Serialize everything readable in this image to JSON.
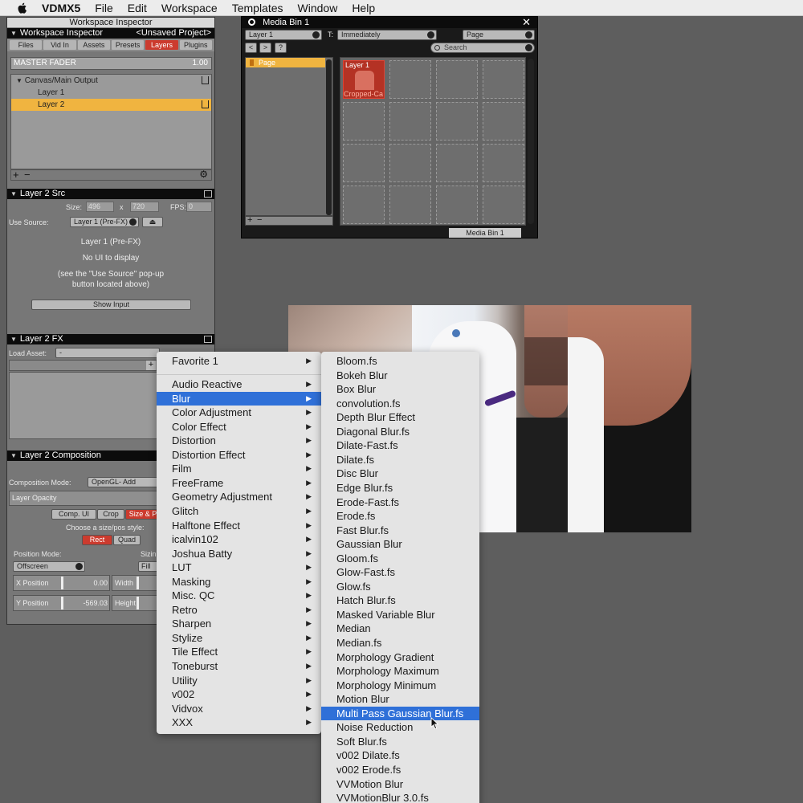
{
  "menubar": {
    "app": "VDMX5",
    "items": [
      "File",
      "Edit",
      "Workspace",
      "Templates",
      "Window",
      "Help"
    ]
  },
  "inspector": {
    "window_title": "Workspace Inspector",
    "header_left": "Workspace Inspector",
    "header_right": "<Unsaved Project>",
    "tabs": [
      "Files",
      "Vid In",
      "Assets",
      "Presets",
      "Layers",
      "Plugins"
    ],
    "selected_tab": "Layers",
    "master_fader_label": "MASTER FADER",
    "master_fader_value": "1.00",
    "tree": {
      "root": "Canvas/Main Output",
      "layer1": "Layer 1",
      "layer2": "Layer 2"
    }
  },
  "src": {
    "header": "Layer 2 Src",
    "size_label": "Size:",
    "size_w": "496",
    "size_x": "x",
    "size_h": "720",
    "fps_label": "FPS:",
    "fps_value": "0",
    "use_source_label": "Use Source:",
    "use_source_value": "Layer 1 (Pre-FX)",
    "source_name": "Layer 1 (Pre-FX)",
    "no_ui": "No UI to display",
    "hint_line1": "(see the \"Use Source\" pop-up",
    "hint_line2": "button located above)",
    "show_input": "Show Input"
  },
  "fx": {
    "header": "Layer 2 FX",
    "load_asset_label": "Load Asset:",
    "load_asset_value": "-",
    "add": "+"
  },
  "composition": {
    "header": "Layer 2 Composition",
    "mode_label": "Composition Mode:",
    "mode_value": "OpenGL- Add",
    "opacity_label": "Layer Opacity",
    "tabs": [
      "Comp. UI",
      "Crop",
      "Size & P"
    ],
    "size_style_label": "Choose a size/pos style:",
    "rect": "Rect",
    "quad": "Quad",
    "position_mode_label": "Position Mode:",
    "position_mode_value": "Offscreen",
    "sizing_label": "Sizin",
    "fill": "Fill",
    "x_label": "X Position",
    "x_value": "0.00",
    "y_label": "Y Position",
    "y_value": "-569.03",
    "width_label": "Width",
    "height_label": "Height"
  },
  "mediabin": {
    "title": "Media Bin 1",
    "close": "✕",
    "layer_popup": "Layer 1",
    "trigger_label": "T:",
    "trigger_popup": "Immediately",
    "page_popup": "Page",
    "search_placeholder": "Search",
    "nav": [
      "<",
      ">",
      "?"
    ],
    "page_item": "Page",
    "clip_title": "Layer 1",
    "clip_name": "Cropped-Ca",
    "footer": "Media Bin 1"
  },
  "context_menu": {
    "favorite": "Favorite 1",
    "items": [
      "Audio Reactive",
      "Blur",
      "Color Adjustment",
      "Color Effect",
      "Distortion",
      "Distortion Effect",
      "Film",
      "FreeFrame",
      "Geometry Adjustment",
      "Glitch",
      "Halftone Effect",
      "icalvin102",
      "Joshua Batty",
      "LUT",
      "Masking",
      "Misc. QC",
      "Retro",
      "Sharpen",
      "Stylize",
      "Tile Effect",
      "Toneburst",
      "Utility",
      "v002",
      "Vidvox",
      "XXX"
    ],
    "selected": "Blur"
  },
  "blur_submenu": {
    "items": [
      "Bloom.fs",
      "Bokeh Blur",
      "Box Blur",
      "convolution.fs",
      "Depth Blur Effect",
      "Diagonal Blur.fs",
      "Dilate-Fast.fs",
      "Dilate.fs",
      "Disc Blur",
      "Edge Blur.fs",
      "Erode-Fast.fs",
      "Erode.fs",
      "Fast Blur.fs",
      "Gaussian Blur",
      "Gloom.fs",
      "Glow-Fast.fs",
      "Glow.fs",
      "Hatch Blur.fs",
      "Masked Variable Blur",
      "Median",
      "Median.fs",
      "Morphology Gradient",
      "Morphology Maximum",
      "Morphology Minimum",
      "Motion Blur",
      "Multi Pass Gaussian Blur.fs",
      "Noise Reduction",
      "Soft Blur.fs",
      "v002 Dilate.fs",
      "v002 Erode.fs",
      "VVMotion Blur",
      "VVMotionBlur 3.0.fs"
    ],
    "selected": "Multi Pass Gaussian Blur.fs"
  },
  "icons": {
    "apple": "apple-logo-icon",
    "triangle": "disclosure-triangle-icon",
    "share": "share-icon",
    "gear": "gear-icon",
    "search": "search-icon",
    "eject": "eject-icon",
    "chevron": "chevron-down-icon",
    "cursor": "mouse-pointer-icon"
  },
  "colors": {
    "selection_orange": "#f0b440",
    "tab_red": "#cc3b2e",
    "menu_blue": "#2f70d8"
  }
}
